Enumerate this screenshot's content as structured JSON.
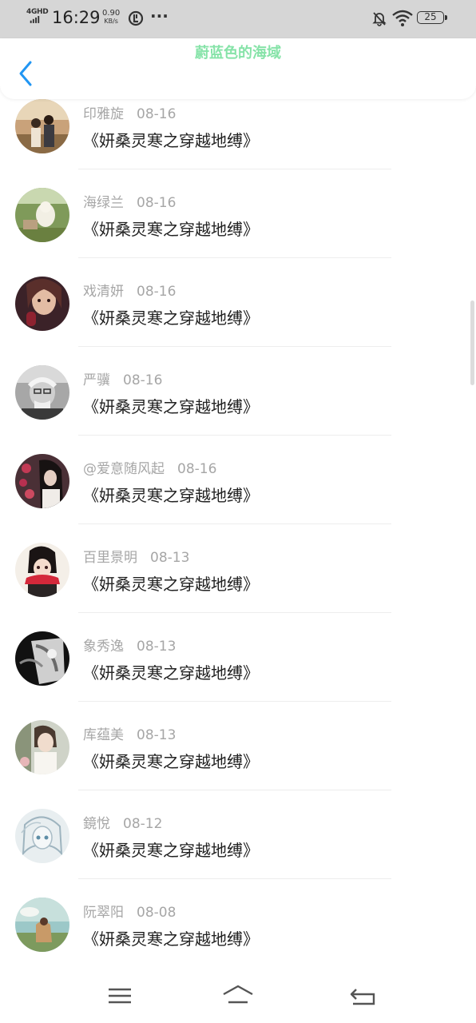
{
  "status_bar": {
    "network": "4GHD",
    "time": "16:29",
    "speed_value": "0.90",
    "speed_unit": "KB/s",
    "dots": "···",
    "battery": "25",
    "icons": [
      "signal-icon",
      "data-indicator-icon",
      "mute-icon",
      "wifi-icon",
      "battery-icon"
    ]
  },
  "header": {
    "title": "蔚蓝色的海域",
    "title_color": "#86e3a8",
    "accent_color": "#2196f3",
    "back_icon": "chevron-left-icon"
  },
  "list": {
    "items": [
      {
        "name": "印雅旋",
        "date": "08-16",
        "title": "《妍桑灵寒之穿越地缚》"
      },
      {
        "name": "海绿兰",
        "date": "08-16",
        "title": "《妍桑灵寒之穿越地缚》"
      },
      {
        "name": "戏清妍",
        "date": "08-16",
        "title": "《妍桑灵寒之穿越地缚》"
      },
      {
        "name": "严骥",
        "date": "08-16",
        "title": "《妍桑灵寒之穿越地缚》"
      },
      {
        "name": "@爱意随风起",
        "date": "08-16",
        "title": "《妍桑灵寒之穿越地缚》"
      },
      {
        "name": "百里景明",
        "date": "08-13",
        "title": "《妍桑灵寒之穿越地缚》"
      },
      {
        "name": "象秀逸",
        "date": "08-13",
        "title": "《妍桑灵寒之穿越地缚》"
      },
      {
        "name": "库蕴美",
        "date": "08-13",
        "title": "《妍桑灵寒之穿越地缚》"
      },
      {
        "name": "鏡悅",
        "date": "08-12",
        "title": "《妍桑灵寒之穿越地缚》"
      },
      {
        "name": "阮翠阳",
        "date": "08-08",
        "title": "《妍桑灵寒之穿越地缚》"
      }
    ]
  },
  "nav_bar": {
    "icons": [
      "menu-icon",
      "home-icon",
      "back-icon"
    ]
  }
}
